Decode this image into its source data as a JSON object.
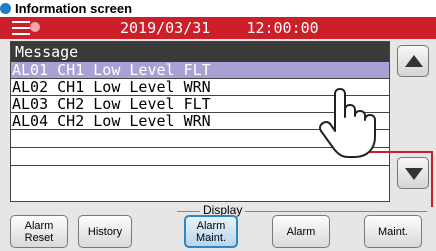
{
  "caption": "Information screen",
  "titlebar": {
    "date": "2019/03/31",
    "time": "12:00:00"
  },
  "message_panel": {
    "header": "Message",
    "rows": [
      "AL01 CH1 Low Level FLT",
      "AL02 CH1 Low Level WRN",
      "AL03 CH2 Low Level FLT",
      "AL04 CH2 Low Level WRN"
    ]
  },
  "display_group": {
    "label": "Display"
  },
  "buttons": {
    "alarm_reset": "Alarm\nReset",
    "history": "History",
    "alarm_maint": "Alarm\nMaint.",
    "alarm": "Alarm",
    "maint": "Maint."
  },
  "colors": {
    "titlebar": "#cc1f2a",
    "selected_row": "#a7a2d3",
    "active_button_border": "#2e86c6",
    "leader_line": "#cc1f2a"
  },
  "icons": {
    "menu": "hamburger-menu-icon",
    "pointer": "hand-pointer-icon",
    "up": "triangle-up-icon",
    "down": "triangle-down-icon"
  }
}
